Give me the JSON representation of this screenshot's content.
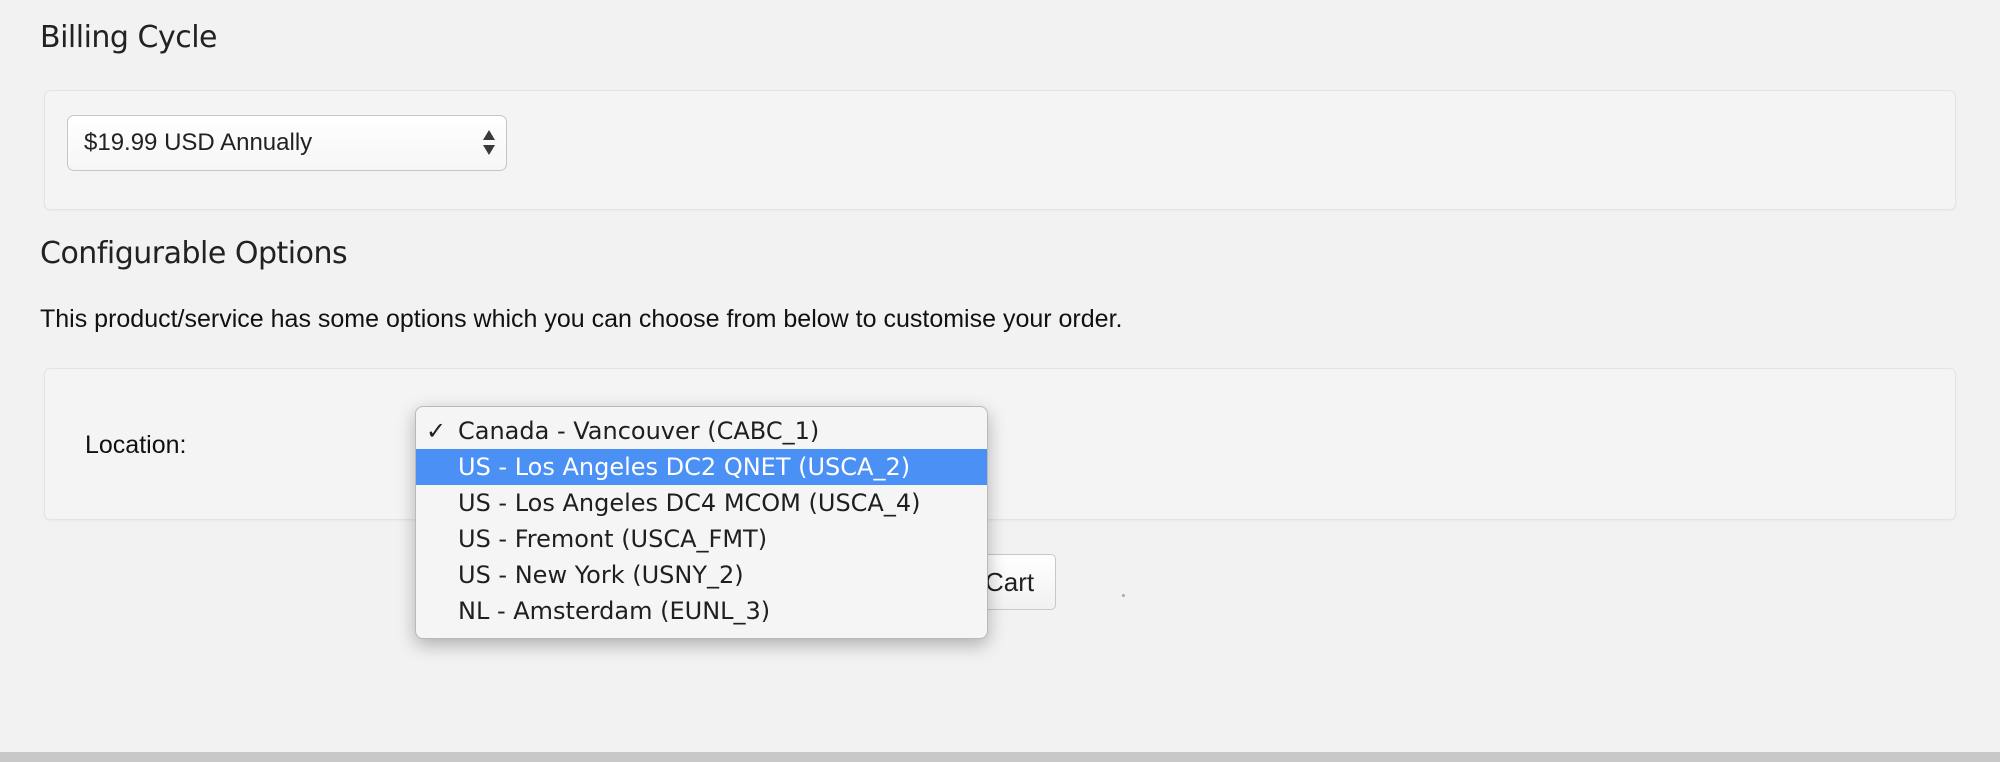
{
  "billing": {
    "heading": "Billing Cycle",
    "selected": "$19.99 USD Annually"
  },
  "config": {
    "heading": "Configurable Options",
    "description": "This product/service has some options which you can choose from below to customise your order.",
    "location_label": "Location:",
    "location_options": [
      {
        "label": "Canada - Vancouver (CABC_1)",
        "checked": true,
        "highlighted": false
      },
      {
        "label": "US - Los Angeles DC2 QNET (USCA_2)",
        "checked": false,
        "highlighted": true
      },
      {
        "label": "US - Los Angeles DC4 MCOM (USCA_4)",
        "checked": false,
        "highlighted": false
      },
      {
        "label": "US - Fremont (USCA_FMT)",
        "checked": false,
        "highlighted": false
      },
      {
        "label": "US - New York (USNY_2)",
        "checked": false,
        "highlighted": false
      },
      {
        "label": "NL - Amsterdam (EUNL_3)",
        "checked": false,
        "highlighted": false
      }
    ],
    "check_glyph": "✓"
  },
  "actions": {
    "add_cart_visible_text": "Cart"
  },
  "colors": {
    "highlight": "#4a90f5",
    "background": "#f2f2f2"
  }
}
